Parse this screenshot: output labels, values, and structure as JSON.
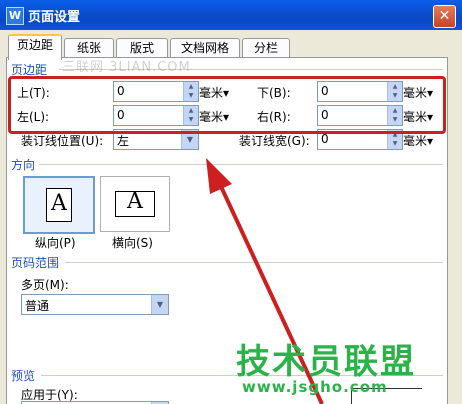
{
  "window": {
    "title": "页面设置",
    "icon": "W"
  },
  "tabs": [
    {
      "label": "页边距",
      "active": true
    },
    {
      "label": "纸张",
      "active": false
    },
    {
      "label": "版式",
      "active": false
    },
    {
      "label": "文档网格",
      "active": false
    },
    {
      "label": "分栏",
      "active": false
    }
  ],
  "margins": {
    "section_title": "页边距",
    "top_label": "上(T):",
    "top_value": "0",
    "top_unit": "毫米",
    "bottom_label": "下(B):",
    "bottom_value": "0",
    "bottom_unit": "毫米",
    "left_label": "左(L):",
    "left_value": "0",
    "left_unit": "毫米",
    "right_label": "右(R):",
    "right_value": "0",
    "right_unit": "毫米",
    "gutter_pos_label": "装订线位置(U):",
    "gutter_pos_value": "左",
    "gutter_width_label": "装订线宽(G):",
    "gutter_width_value": "0",
    "gutter_width_unit": "毫米"
  },
  "orientation": {
    "section_title": "方向",
    "portrait_label": "纵向(P)",
    "landscape_label": "横向(S)",
    "glyph": "A"
  },
  "pages": {
    "section_title": "页码范围",
    "multiple_label": "多页(M):",
    "multiple_value": "普通"
  },
  "preview": {
    "section_title": "预览",
    "apply_label": "应用于(Y):"
  },
  "watermarks": {
    "top": "三联网 3LIAN.COM",
    "brand": "技术员联盟",
    "url": "www.jsgho.com"
  },
  "colors": {
    "highlight": "#cc1f1f",
    "arrow": "#cc1f1f",
    "brand": "#2bb34a"
  }
}
